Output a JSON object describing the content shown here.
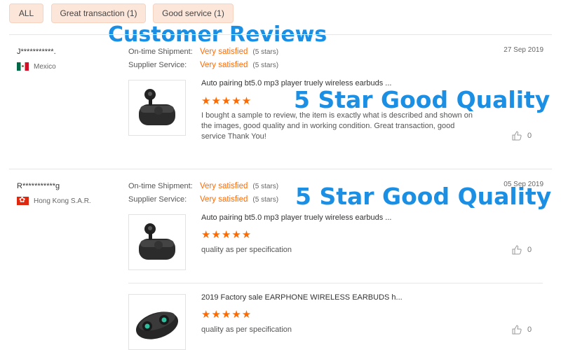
{
  "filters": {
    "all": "ALL",
    "great_transaction": "Great transaction (1)",
    "good_service": "Good service (1)"
  },
  "overlay": {
    "heading": "Customer Reviews",
    "caption": "5 Star Good Quality"
  },
  "labels": {
    "shipment": "On-time Shipment:",
    "service": "Supplier Service:",
    "satisfied": "Very satisfied",
    "five_stars": "(5 stars)",
    "stars_glyphs": "★★★★★"
  },
  "colors": {
    "accent": "#ff6a00",
    "tab_bg": "#fce6da",
    "overlay_blue": "#1a8fe3"
  },
  "reviews": [
    {
      "reviewer": "J***********.",
      "country": "Mexico",
      "flag_icon": "mexico-flag-icon",
      "date": "27 Sep 2019",
      "rating": 5,
      "items": [
        {
          "product": "Auto pairing bt5.0 mp3 player truely wireless earbuds ...",
          "comment": "I bought a sample to review, the item is exactly what is described and shown on the images, good quality and in working condition. Great transaction, good service Thank You!",
          "likes": "0"
        }
      ]
    },
    {
      "reviewer": "R***********g",
      "country": "Hong Kong S.A.R.",
      "flag_icon": "hong-kong-flag-icon",
      "date": "05 Sep 2019",
      "rating": 5,
      "items": [
        {
          "product": "Auto pairing bt5.0 mp3 player truely wireless earbuds ...",
          "comment": "quality as per specification",
          "likes": "0"
        },
        {
          "product": "2019 Factory sale EARPHONE WIRELESS EARBUDS h...",
          "comment": "quality as per specification",
          "likes": "0"
        }
      ]
    }
  ]
}
